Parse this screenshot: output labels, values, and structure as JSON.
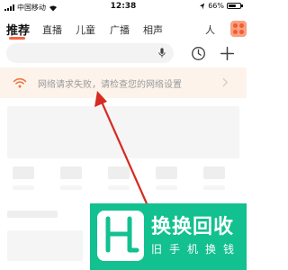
{
  "status_bar": {
    "carrier": "中国移动",
    "time": "12:38",
    "battery_percent": "66%",
    "battery_level": 0.66,
    "icons": [
      "signal-icon",
      "wifi-icon",
      "location-icon",
      "battery-icon"
    ]
  },
  "tabs": {
    "items": [
      "推荐",
      "直播",
      "儿童",
      "广播",
      "相声",
      "人"
    ],
    "active": "推荐",
    "accent_color": "#f86442",
    "more_icon": "category-grid-icon"
  },
  "search": {
    "placeholder": "",
    "icons": [
      "mic-icon",
      "history-clock-icon",
      "plus-icon"
    ]
  },
  "network_banner": {
    "message": "网络请求失败，请检查您的网络设置",
    "icon": "wifi-warning-icon",
    "icon_color": "#f0733d",
    "background": "#fdf3eb"
  },
  "annotation": {
    "arrow_color": "#d62b22"
  },
  "watermark": {
    "title": "换换回收",
    "subtitle": "旧手机换钱",
    "logo_color": "#13c08f"
  }
}
